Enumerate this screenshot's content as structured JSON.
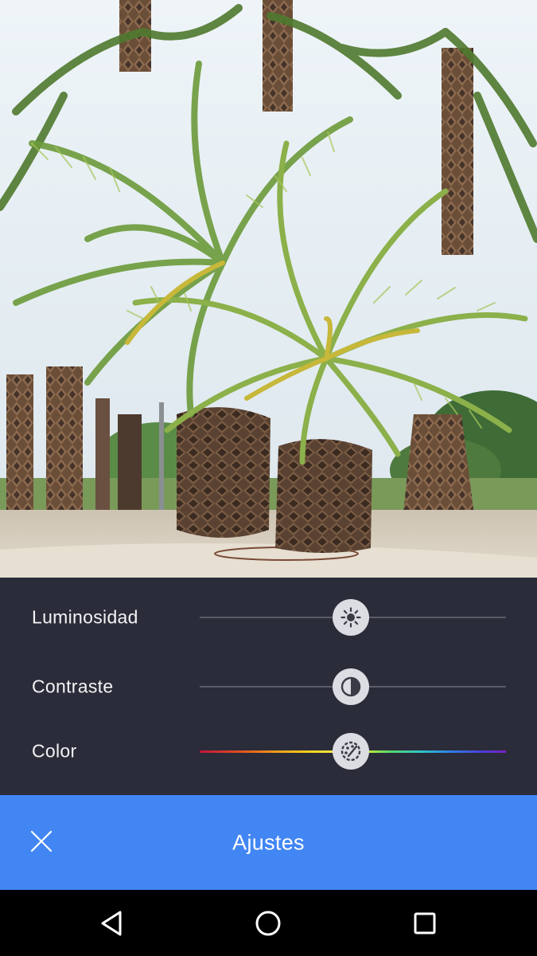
{
  "photo": {
    "subject": "palm-trees-photo"
  },
  "adjustments": [
    {
      "key": "brightness",
      "label": "Luminosidad",
      "value": 0.5,
      "icon": "brightness-icon",
      "track": "neutral"
    },
    {
      "key": "contrast",
      "label": "Contraste",
      "value": 0.5,
      "icon": "contrast-icon",
      "track": "neutral"
    },
    {
      "key": "color",
      "label": "Color",
      "value": 0.5,
      "icon": "color-palette-icon",
      "track": "rainbow"
    }
  ],
  "actionbar": {
    "title": "Ajustes",
    "close_icon": "close-icon",
    "color": "#4286f4"
  },
  "navigation": {
    "back_icon": "back-triangle-icon",
    "home_icon": "home-circle-icon",
    "recents_icon": "recents-square-icon"
  },
  "colors": {
    "panel": "#2b2c39",
    "knob": "#dcdde2",
    "accent": "#4286f4"
  }
}
